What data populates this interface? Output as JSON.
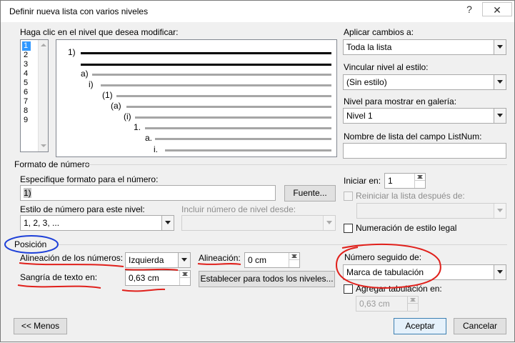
{
  "window": {
    "title": "Definir nueva lista con varios niveles",
    "help_label": "?",
    "close_label": "✕"
  },
  "levels": {
    "label": "Haga clic en el nivel que desea modificar:",
    "items": [
      "1",
      "2",
      "3",
      "4",
      "5",
      "6",
      "7",
      "8",
      "9"
    ],
    "selected": "1"
  },
  "preview": {
    "numbers": [
      "1)",
      "a)",
      "i)",
      "(1)",
      "(a)",
      "(i)",
      "1.",
      "a.",
      "i."
    ]
  },
  "apply_to": {
    "label": "Aplicar cambios a:",
    "value": "Toda la lista"
  },
  "link_style": {
    "label": "Vincular nivel al estilo:",
    "value": "(Sin estilo)"
  },
  "gallery_level": {
    "label": "Nivel para mostrar en galería:",
    "value": "Nivel 1"
  },
  "listnum": {
    "label": "Nombre de lista del campo ListNum:",
    "value": ""
  },
  "number_format": {
    "section_label": "Formato de número",
    "format_label": "Especifique formato para el número:",
    "format_value": "1)",
    "font_button": "Fuente...",
    "style_label": "Estilo de número para este nivel:",
    "style_value": "1, 2, 3, ...",
    "include_label": "Incluir número de nivel desde:",
    "include_value": "",
    "start_label": "Iniciar en:",
    "start_value": "1",
    "restart_label": "Reiniciar la lista después de:",
    "restart_value": "",
    "legal_label": "Numeración de estilo legal"
  },
  "position": {
    "section_label": "Posición",
    "alignment_label": "Alineación de los números:",
    "alignment_value": "Izquierda",
    "align_at_label": "Alineación:",
    "align_at_value": "0 cm",
    "indent_label": "Sangría de texto en:",
    "indent_value": "0,63 cm",
    "set_all_button": "Establecer para todos los niveles...",
    "follow_label": "Número seguido de:",
    "follow_value": "Marca de tabulación",
    "add_tab_label": "Agregar tabulación en:",
    "add_tab_value": "0,63 cm"
  },
  "footer": {
    "less_button": "<< Menos",
    "ok_button": "Aceptar",
    "cancel_button": "Cancelar"
  },
  "colors": {
    "annotation_red": "#e0201b",
    "annotation_blue": "#1d3fd8",
    "selection": "#3399ff"
  }
}
